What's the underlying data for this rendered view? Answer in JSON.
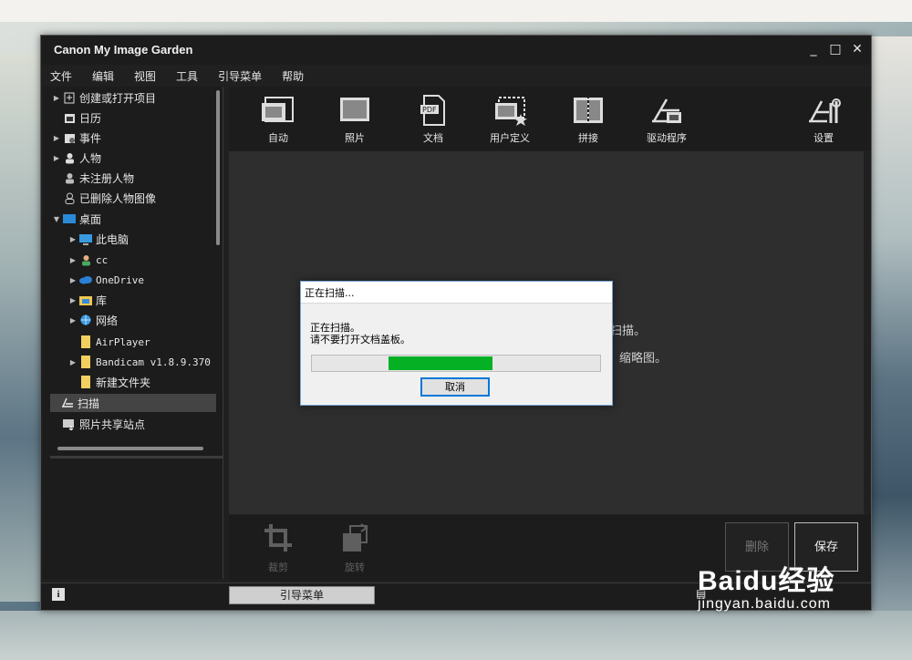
{
  "window": {
    "title": "Canon My Image Garden"
  },
  "window_controls": {
    "minimize": "_",
    "maximize": "□",
    "close": "✕"
  },
  "menubar": [
    "文件",
    "编辑",
    "视图",
    "工具",
    "引导菜单",
    "帮助"
  ],
  "sidebar": {
    "items": [
      {
        "label": "创建或打开项目",
        "expander": "▶",
        "icon": "project-icon"
      },
      {
        "label": "日历",
        "expander": "",
        "icon": "calendar-icon"
      },
      {
        "label": "事件",
        "expander": "▶",
        "icon": "event-icon"
      },
      {
        "label": "人物",
        "expander": "▶",
        "icon": "person-icon"
      },
      {
        "label": "未注册人物",
        "expander": "",
        "icon": "unregistered-person-icon"
      },
      {
        "label": "已删除人物图像",
        "expander": "",
        "icon": "deleted-person-icon"
      },
      {
        "label": "桌面",
        "expander": "▼",
        "icon": "desktop-icon"
      },
      {
        "label": "此电脑",
        "expander": "▶",
        "icon": "computer-icon"
      },
      {
        "label": "cc",
        "expander": "▶",
        "icon": "user-folder-icon"
      },
      {
        "label": "OneDrive",
        "expander": "▶",
        "icon": "cloud-icon"
      },
      {
        "label": "库",
        "expander": "▶",
        "icon": "library-icon"
      },
      {
        "label": "网络",
        "expander": "▶",
        "icon": "network-icon"
      },
      {
        "label": "AirPlayer",
        "expander": "",
        "icon": "folder-icon"
      },
      {
        "label": "Bandicam v1.8.9.370",
        "expander": "▶",
        "icon": "folder-icon"
      },
      {
        "label": "新建文件夹",
        "expander": "",
        "icon": "folder-icon"
      },
      {
        "label": "扫描",
        "expander": "",
        "icon": "scan-icon"
      },
      {
        "label": "照片共享站点",
        "expander": "",
        "icon": "photo-share-icon"
      }
    ]
  },
  "toolbar": {
    "tools": [
      {
        "label": "自动",
        "icon": "auto-scan-icon"
      },
      {
        "label": "照片",
        "icon": "photo-scan-icon"
      },
      {
        "label": "文档",
        "icon": "document-pdf-icon"
      },
      {
        "label": "用户定义",
        "icon": "custom-scan-icon"
      },
      {
        "label": "拼接",
        "icon": "stitch-icon"
      },
      {
        "label": "驱动程序",
        "icon": "driver-icon"
      },
      {
        "label": "设置",
        "icon": "settings-icon"
      }
    ]
  },
  "content": {
    "line1": "扫描。",
    "line2": "缩略图。"
  },
  "bottombar": {
    "crop": "裁剪",
    "rotate": "旋转",
    "delete": "删除",
    "save": "保存"
  },
  "statusbar": {
    "info": "i",
    "guide": "引导菜单"
  },
  "dialog": {
    "title": "正在扫描...",
    "message1": "正在扫描。",
    "message2": "请不要打开文档盖板。",
    "progress": 0.36,
    "cancel": "取消"
  },
  "watermark": {
    "main": "Baidu经验",
    "sub": "jingyan.baidu.com"
  },
  "colors": {
    "progress": "#06b025",
    "dialog_focus": "#0078d7",
    "window_bg": "#202020"
  }
}
